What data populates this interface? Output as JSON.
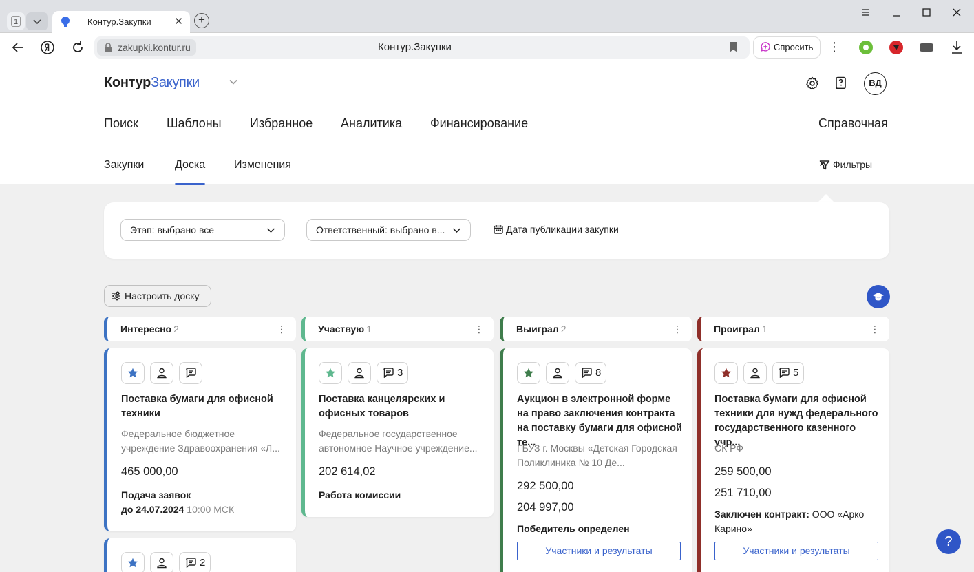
{
  "browser": {
    "tab_counter": "1",
    "tab_title": "Контур.Закупки",
    "url_host": "zakupki.kontur.ru",
    "url_title": "Контур.Закупки",
    "ask_label": "Спросить"
  },
  "header": {
    "logo_main": "Контур",
    "logo_accent": "Закупки",
    "avatar": "ВД"
  },
  "main_nav": [
    "Поиск",
    "Шаблоны",
    "Избранное",
    "Аналитика",
    "Финансирование"
  ],
  "help_link": "Справочная",
  "sub_nav": [
    "Закупки",
    "Доска",
    "Изменения"
  ],
  "sub_nav_active": "Доска",
  "filters_toggle": "Фильтры",
  "filters": {
    "stage": "Этап: выбрано все",
    "responsible": "Ответственный: выбрано в...",
    "date": "Дата публикации закупки"
  },
  "configure_label": "Настроить доску",
  "help_button": "?",
  "colors": {
    "accent": "#3a63cc",
    "col_interesting": "#3d73c3",
    "col_participate": "#5fb88f",
    "col_won": "#3f7d4c",
    "col_lost": "#8f2f2a"
  },
  "columns": [
    {
      "title": "Интересно",
      "count": "2"
    },
    {
      "title": "Участвую",
      "count": "1"
    },
    {
      "title": "Выиграл",
      "count": "2"
    },
    {
      "title": "Проиграл",
      "count": "1"
    }
  ],
  "cards": {
    "c1": {
      "title": "Поставка бумаги для офисной техники",
      "org": "Федеральное бюджетное учреждение Здравоохранения «Л...",
      "price": "465 000,00",
      "status_label": "Подача заявок",
      "status_date": "до 24.07.2024",
      "status_time": "10:00 МСК"
    },
    "c1b": {
      "comments": "2"
    },
    "c2": {
      "comments": "3",
      "title": "Поставка канцелярских и офисных товаров",
      "org": "Федеральное государственное автономное Научное учреждение...",
      "price": "202 614,02",
      "status": "Работа комиссии"
    },
    "c3": {
      "comments": "8",
      "title": "Аукцион в электронной форме на право заключения контракта на поставку бумаги для офисной те...",
      "org": "ГБУЗ г. Москвы «Детская Городская Поликлиника № 10 Де...",
      "price1": "292 500,00",
      "price2": "204 997,00",
      "status": "Победитель определен",
      "results": "Участники и результаты"
    },
    "c4": {
      "comments": "5",
      "title": "Поставка бумаги для офисной техники для нужд федерального государственного казенного учр...",
      "org": "СК РФ",
      "price1": "259 500,00",
      "price2": "251 710,00",
      "status_label": "Заключен контракт:",
      "status_value": "ООО «Арко Карино»",
      "results": "Участники и результаты"
    }
  }
}
